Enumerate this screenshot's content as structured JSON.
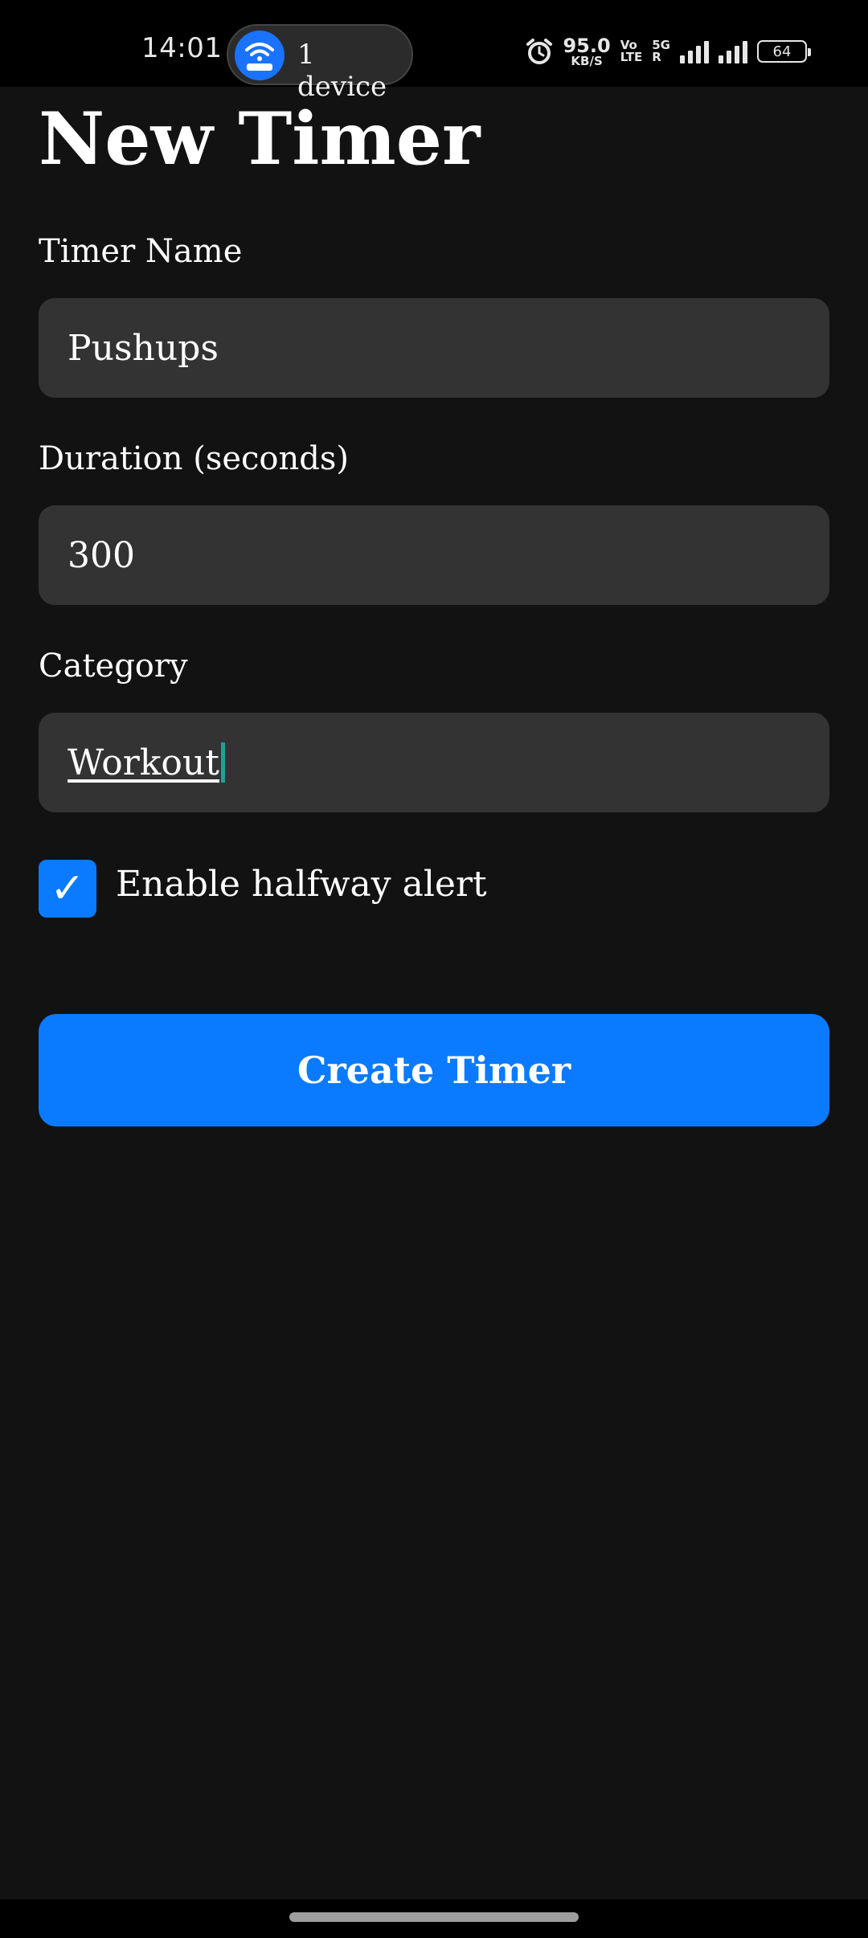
{
  "status_bar": {
    "time": "14:01",
    "hotspot_label": "1 device",
    "net_speed_value": "95.0",
    "net_speed_unit": "KB/S",
    "volte_top": "Vo",
    "volte_bottom": "LTE",
    "network_top": "5G",
    "network_bottom": "R",
    "battery_level": "64",
    "icons": [
      "hotspot-icon",
      "alarm-icon",
      "signal-icon",
      "battery-icon"
    ]
  },
  "page": {
    "title": "New Timer"
  },
  "form": {
    "timer_name": {
      "label": "Timer Name",
      "value": "Pushups"
    },
    "duration": {
      "label": "Duration (seconds)",
      "value": "300"
    },
    "category": {
      "label": "Category",
      "value": "Workout"
    },
    "halfway_alert": {
      "label": "Enable halfway alert",
      "checked": true,
      "check_glyph": "✓"
    },
    "submit_label": "Create Timer"
  },
  "colors": {
    "background": "#121212",
    "input_background": "#333333",
    "accent": "#0a7bff",
    "caret": "#1aa39a"
  }
}
